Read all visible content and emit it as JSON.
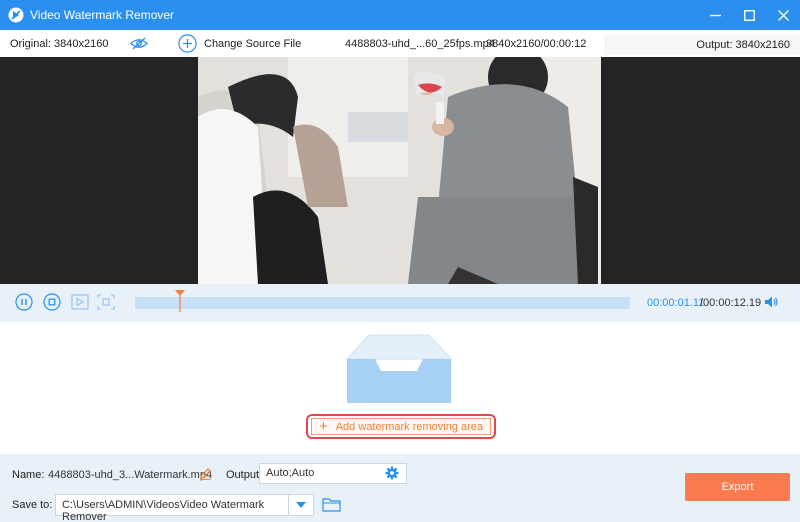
{
  "window": {
    "title": "Video Watermark Remover",
    "controls": [
      "minimize-icon",
      "maximize-icon",
      "close-icon"
    ]
  },
  "info_bar": {
    "original": "Original: 3840x2160",
    "change_source": "Change Source File",
    "file_name": "4488803-uhd_...60_25fps.mp4",
    "dims_duration": "3840x2160/00:00:12",
    "output": "Output: 3840x2160"
  },
  "playback": {
    "current_time": "00:00:01.11",
    "total_time": "/00:00:12.19",
    "progress": 0.091,
    "buttons": [
      "pause-icon",
      "stop-icon",
      "prev-frame-icon",
      "next-frame-icon"
    ]
  },
  "empty_state": {
    "icon": "empty-tray-icon",
    "add_button": "Add watermark removing area"
  },
  "bottom": {
    "name_label": "Name:",
    "name_value": "4488803-uhd_3...Watermark.mp4",
    "output_label": "Output:",
    "output_value": "Auto;Auto",
    "save_label": "Save to:",
    "save_value": "C:\\Users\\ADMIN\\VideosVideo Watermark Remover",
    "export_label": "Export"
  },
  "colors": {
    "accent": "#2b8ff0",
    "export": "#fb7a4f",
    "highlight": "#e8454f"
  }
}
